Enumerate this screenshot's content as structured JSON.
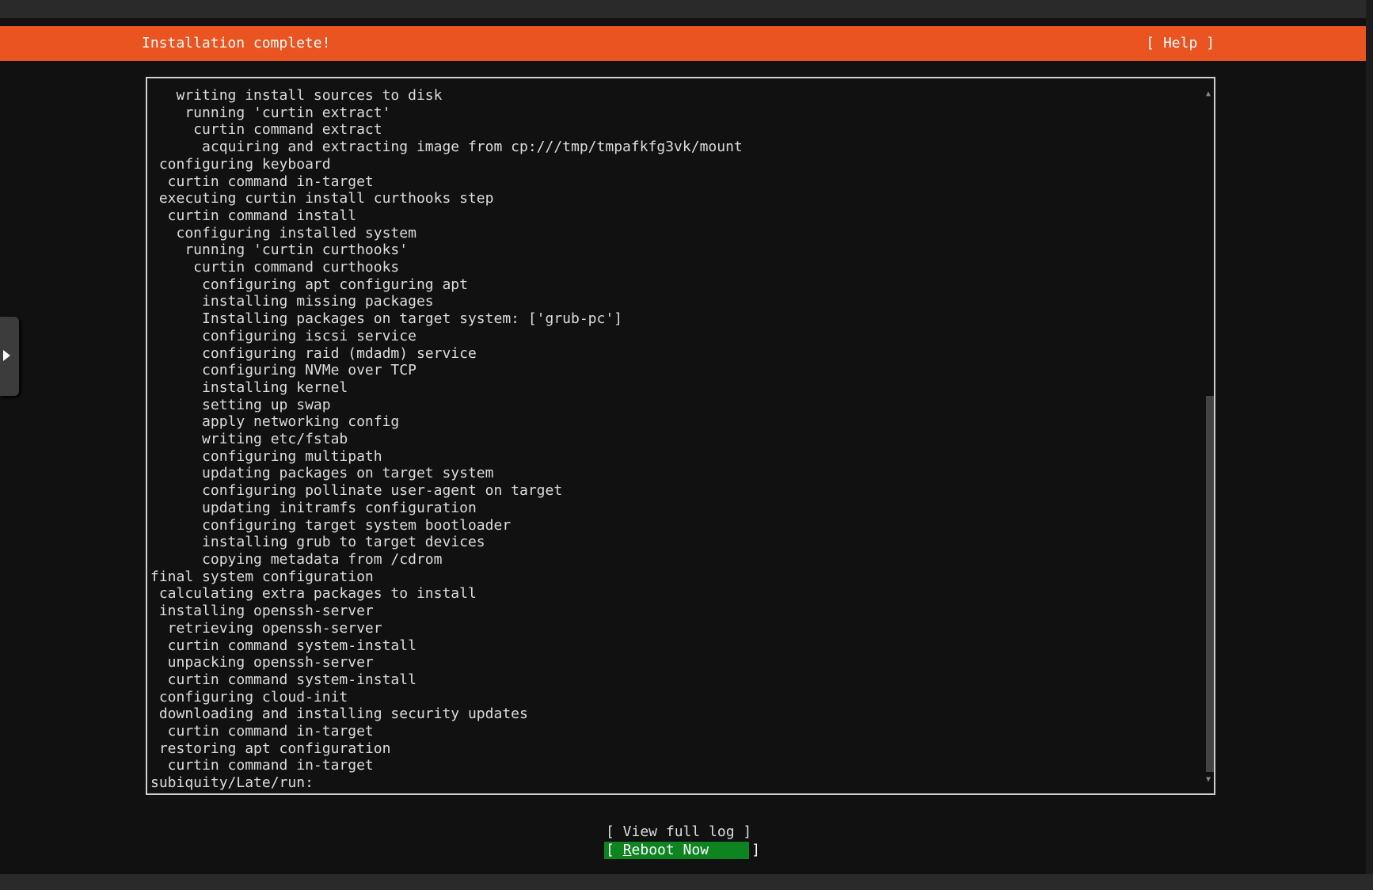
{
  "header": {
    "title": "Installation complete!",
    "help_label": "[ Help ]"
  },
  "log_lines": [
    "   writing install sources to disk",
    "    running 'curtin extract'",
    "     curtin command extract",
    "      acquiring and extracting image from cp:///tmp/tmpafkfg3vk/mount",
    " configuring keyboard",
    "  curtin command in-target",
    " executing curtin install curthooks step",
    "  curtin command install",
    "   configuring installed system",
    "    running 'curtin curthooks'",
    "     curtin command curthooks",
    "      configuring apt configuring apt",
    "      installing missing packages",
    "      Installing packages on target system: ['grub-pc']",
    "      configuring iscsi service",
    "      configuring raid (mdadm) service",
    "      configuring NVMe over TCP",
    "      installing kernel",
    "      setting up swap",
    "      apply networking config",
    "      writing etc/fstab",
    "      configuring multipath",
    "      updating packages on target system",
    "      configuring pollinate user-agent on target",
    "      updating initramfs configuration",
    "      configuring target system bootloader",
    "      installing grub to target devices",
    "      copying metadata from /cdrom",
    "final system configuration",
    " calculating extra packages to install",
    " installing openssh-server",
    "  retrieving openssh-server",
    "  curtin command system-install",
    "  unpacking openssh-server",
    "  curtin command system-install",
    " configuring cloud-init",
    " downloading and installing security updates",
    "  curtin command in-target",
    " restoring apt configuration",
    "  curtin command in-target",
    "subiquity/Late/run:"
  ],
  "buttons": {
    "view_log": "[ View full log ]",
    "reboot_prefix": "[ ",
    "reboot_hotkey": "R",
    "reboot_rest": "eboot Now     ]"
  },
  "colors": {
    "accent": "#e95420",
    "button_focus": "#0e8420"
  }
}
